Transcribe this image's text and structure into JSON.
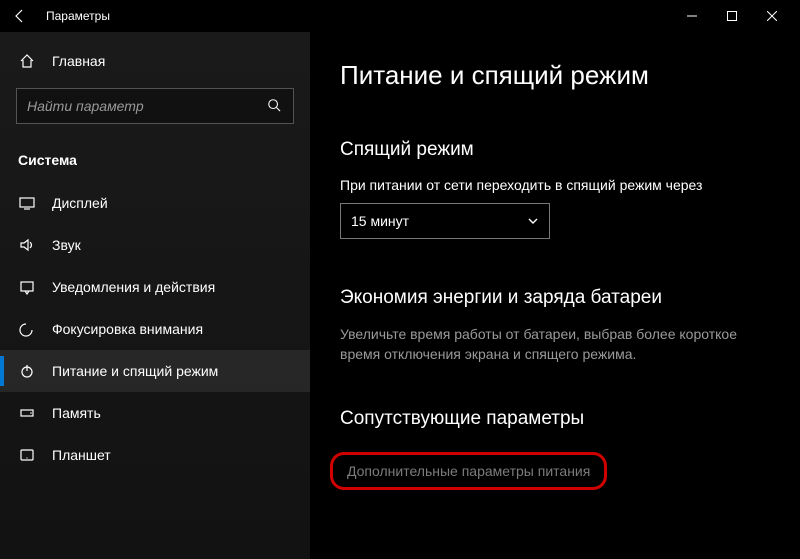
{
  "window": {
    "title": "Параметры"
  },
  "sidebar": {
    "home": "Главная",
    "search_placeholder": "Найти параметр",
    "category": "Система",
    "items": [
      {
        "label": "Дисплей"
      },
      {
        "label": "Звук"
      },
      {
        "label": "Уведомления и действия"
      },
      {
        "label": "Фокусировка внимания"
      },
      {
        "label": "Питание и спящий режим"
      },
      {
        "label": "Память"
      },
      {
        "label": "Планшет"
      }
    ]
  },
  "main": {
    "title": "Питание и спящий режим",
    "sleep": {
      "heading": "Спящий режим",
      "plugged_label": "При питании от сети переходить в спящий режим через",
      "plugged_value": "15 минут"
    },
    "battery": {
      "heading": "Экономия энергии и заряда батареи",
      "desc": "Увеличьте время работы от батареи, выбрав более короткое время отключения экрана и спящего режима."
    },
    "related": {
      "heading": "Сопутствующие параметры",
      "link1": "Дополнительные параметры питания"
    }
  }
}
